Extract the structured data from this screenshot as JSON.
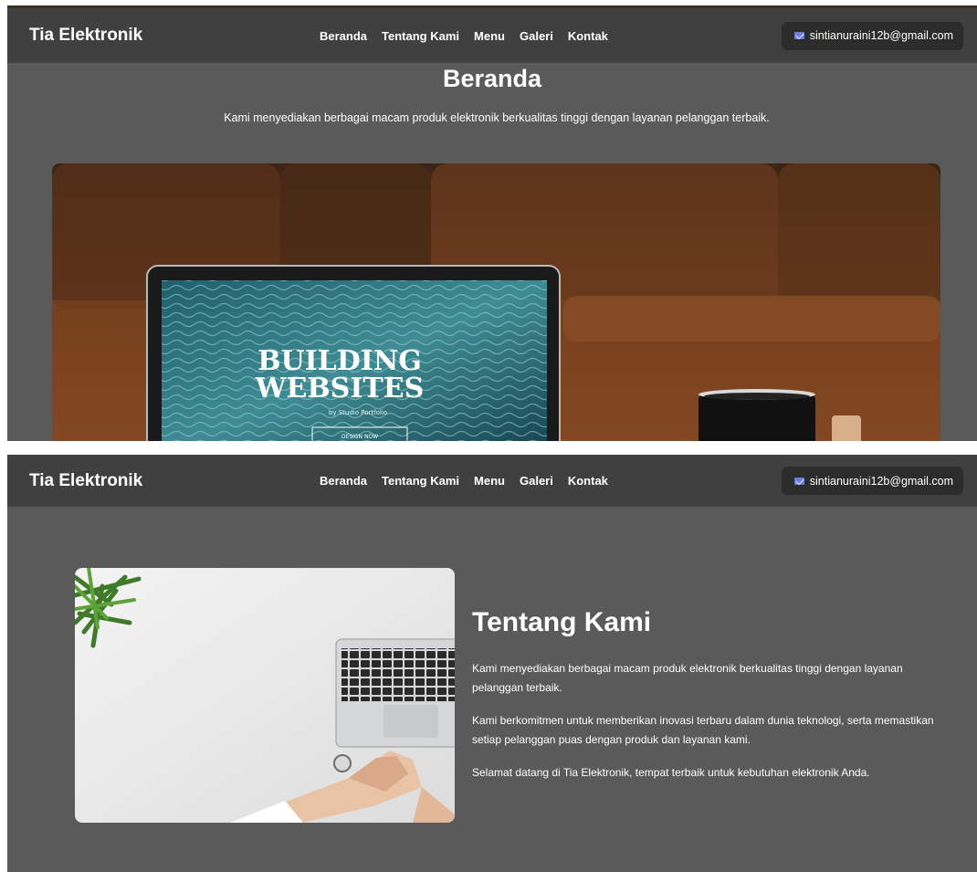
{
  "brand": "Tia Elektronik",
  "nav": {
    "items": [
      {
        "label": "Beranda"
      },
      {
        "label": "Tentang Kami"
      },
      {
        "label": "Menu"
      },
      {
        "label": "Galeri"
      },
      {
        "label": "Kontak"
      }
    ]
  },
  "email": {
    "icon": "mail-icon",
    "address": "sintianuraini12b@gmail.com"
  },
  "hero": {
    "title": "Beranda",
    "text": "Kami menyediakan berbagai macam produk elektronik berkualitas tinggi dengan layanan pelanggan terbaik.",
    "image_text": {
      "line1": "BUILDING",
      "line2": "WEBSITES",
      "sub": "by Studio Portfolio",
      "button": "DESIGN NOW"
    }
  },
  "about": {
    "title": "Tentang Kami",
    "paragraphs": [
      "Kami menyediakan berbagai macam produk elektronik berkualitas tinggi dengan layanan pelanggan terbaik.",
      "Kami berkomitmen untuk memberikan inovasi terbaru dalam dunia teknologi, serta memastikan setiap pelanggan puas dengan produk dan layanan kami.",
      "Selamat datang di Tia Elektronik, tempat terbaik untuk kebutuhan elektronik Anda."
    ]
  },
  "colors": {
    "page_bg": "#5a5a5a",
    "navbar_bg": "#404040",
    "pill_bg": "#2c2c2c",
    "text": "#ffffff"
  }
}
